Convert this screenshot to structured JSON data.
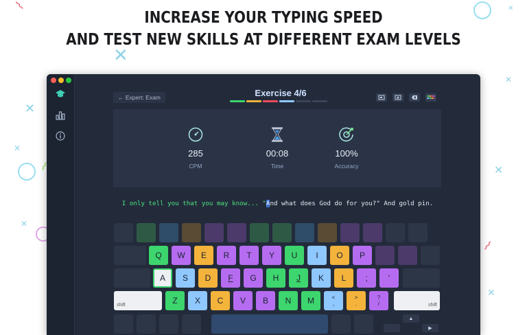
{
  "headline": {
    "line1": "INCREASE YOUR TYPING SPEED",
    "line2": "AND TEST NEW SKILLS AT DIFFERENT EXAM LEVELS"
  },
  "colors": {
    "window_bg": "#232b3b",
    "sidebar_bg": "#1c2331",
    "panel_bg": "#2b3447",
    "accent_green": "#4ee27d",
    "accent_blue": "#8fc7ff",
    "traffic": [
      "#ff5f57",
      "#ffbd2e",
      "#28c840"
    ],
    "progress": [
      "#3dd56d",
      "#f4b33b",
      "#ef4a5e",
      "#8fc7ff",
      "#3a4458",
      "#3a4458"
    ]
  },
  "sidebar": {
    "items": [
      {
        "icon": "graduation-cap-icon",
        "active": true
      },
      {
        "icon": "bar-chart-icon",
        "active": false
      },
      {
        "icon": "info-icon",
        "active": false
      }
    ]
  },
  "header": {
    "back_label": "← Expert: Exam",
    "exercise_title": "Exercise 4/6",
    "toolbar_icons": [
      "fullscreen-icon",
      "keyboard-layout-icon",
      "delete-icon",
      "color-keyboard-icon"
    ]
  },
  "stats": {
    "cpm": {
      "value": "285",
      "label": "CPM",
      "icon": "speedometer-icon"
    },
    "time": {
      "value": "00:08",
      "label": "Time",
      "icon": "hourglass-icon"
    },
    "accuracy": {
      "value": "100%",
      "label": "Accuracy",
      "icon": "target-icon"
    }
  },
  "typing": {
    "typed": "I only tell you that you may know... \"",
    "cursor": "A",
    "remaining": "nd what does God do for you?\" And gold pin."
  },
  "keyboard": {
    "row_q": [
      "Q",
      "W",
      "E",
      "R",
      "T",
      "Y",
      "U",
      "I",
      "O",
      "P"
    ],
    "row_a": [
      "A",
      "S",
      "D",
      "F",
      "G",
      "H",
      "J",
      "K",
      "L",
      ";",
      "'"
    ],
    "row_z": [
      "Z",
      "X",
      "C",
      "V",
      "B",
      "N",
      "M",
      "<",
      ">",
      "?"
    ],
    "row_z_upper": [
      "",
      "",
      "",
      "",
      "",
      "",
      "",
      "<",
      ">",
      "?"
    ],
    "row_z_lower": [
      "",
      "",
      "",
      "",
      "",
      "",
      "",
      ",",
      ".",
      "/"
    ],
    "shift_label": "shift",
    "arrow_up": "▲",
    "arrow_right": "▶"
  }
}
